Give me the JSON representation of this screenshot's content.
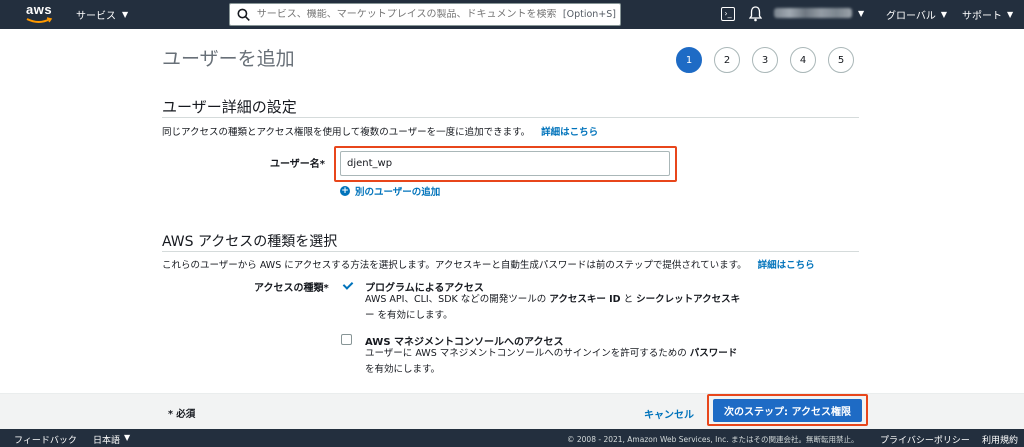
{
  "nav": {
    "logo_text": "aws",
    "services_label": "サービス",
    "search_placeholder": "サービス、機能、マーケットプレイスの製品、ドキュメントを検索",
    "search_shortcut": "[Option+S]",
    "region_label": "グローバル",
    "support_label": "サポート"
  },
  "page": {
    "title": "ユーザーを追加",
    "steps": [
      "1",
      "2",
      "3",
      "4",
      "5"
    ],
    "active_step": 1
  },
  "user_details": {
    "title": "ユーザー詳細の設定",
    "description": "同じアクセスの種類とアクセス権限を使用して複数のユーザーを一度に追加できます。",
    "more_link": "詳細はこちら",
    "username_label": "ユーザー名*",
    "username_value": "djent_wp",
    "add_user_link": "別のユーザーの追加"
  },
  "access_type": {
    "title": "AWS アクセスの種類を選択",
    "description": "これらのユーザーから AWS にアクセスする方法を選択します。アクセスキーと自動生成パスワードは前のステップで提供されています。",
    "more_link": "詳細はこちら",
    "label": "アクセスの種類*",
    "options": [
      {
        "title": "プログラムによるアクセス",
        "checked": true,
        "desc_1": "AWS API、CLI、SDK などの開発ツールの",
        "desc_bold_1": "アクセスキー ID",
        "desc_2": "と",
        "desc_bold_2": "シークレットアクセスキ",
        "desc_3": "ー を有効にします。"
      },
      {
        "title": "AWS マネジメントコンソールへのアクセス",
        "checked": false,
        "desc_1": "ユーザーに AWS マネジメントコンソールへのサインインを許可するための",
        "desc_bold_1": "パスワード",
        "desc_3": "を有効にします。"
      }
    ]
  },
  "footer_actions": {
    "required_note": "* 必須",
    "cancel_label": "キャンセル",
    "next_label": "次のステップ: アクセス権限"
  },
  "console_footer": {
    "feedback": "フィードバック",
    "language": "日本語",
    "copyright": "© 2008 - 2021, Amazon Web Services, Inc. またはその関連会社。無断転用禁止。",
    "privacy": "プライバシーポリシー",
    "terms": "利用規約"
  },
  "colors": {
    "nav_bg": "#232f3e",
    "primary": "#1e6bc5",
    "link": "#0073bb",
    "highlight": "#e8461b"
  }
}
